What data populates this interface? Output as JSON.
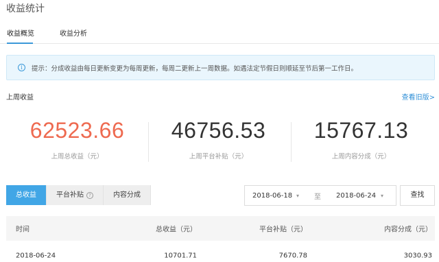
{
  "page_title": "收益统计",
  "tabs": [
    {
      "label": "收益概览",
      "active": true
    },
    {
      "label": "收益分析",
      "active": false
    }
  ],
  "notice": {
    "icon": "info-icon",
    "text": "提示：分成收益由每日更新变更为每周更新，每周二更新上一周数据。如遇法定节假日则顺延至节后第一工作日。"
  },
  "section": {
    "title": "上周收益",
    "old_link": "查看旧版>"
  },
  "stats": [
    {
      "value": "62523.66",
      "label": "上周总收益（元）"
    },
    {
      "value": "46756.53",
      "label": "上周平台补贴（元）"
    },
    {
      "value": "15767.13",
      "label": "上周内容分成（元）"
    }
  ],
  "filters": {
    "segments": [
      "总收益",
      "平台补贴",
      "内容分成"
    ],
    "active_segment": "总收益",
    "start_date": "2018-06-18",
    "separator": "至",
    "end_date": "2018-06-24",
    "search_label": "查找"
  },
  "table": {
    "columns": [
      "时间",
      "总收益（元）",
      "平台补贴（元）",
      "内容分成（元）"
    ],
    "rows": [
      [
        "2018-06-24",
        "10701.71",
        "7670.78",
        "3030.93"
      ]
    ]
  },
  "colors": {
    "accent_value": "#ee6a50",
    "primary": "#41a6e6",
    "link": "#2f8fd7",
    "notice_bg": "#eaf6fd"
  }
}
